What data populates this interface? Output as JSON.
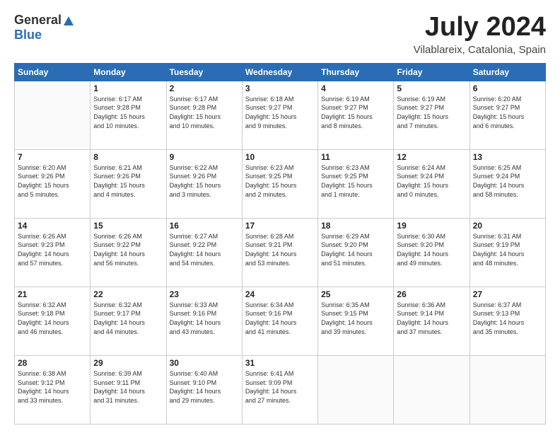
{
  "logo": {
    "general": "General",
    "blue": "Blue"
  },
  "header": {
    "title": "July 2024",
    "subtitle": "Vilablareix, Catalonia, Spain"
  },
  "weekdays": [
    "Sunday",
    "Monday",
    "Tuesday",
    "Wednesday",
    "Thursday",
    "Friday",
    "Saturday"
  ],
  "weeks": [
    [
      {
        "day": "",
        "info": ""
      },
      {
        "day": "1",
        "info": "Sunrise: 6:17 AM\nSunset: 9:28 PM\nDaylight: 15 hours\nand 10 minutes."
      },
      {
        "day": "2",
        "info": "Sunrise: 6:17 AM\nSunset: 9:28 PM\nDaylight: 15 hours\nand 10 minutes."
      },
      {
        "day": "3",
        "info": "Sunrise: 6:18 AM\nSunset: 9:27 PM\nDaylight: 15 hours\nand 9 minutes."
      },
      {
        "day": "4",
        "info": "Sunrise: 6:19 AM\nSunset: 9:27 PM\nDaylight: 15 hours\nand 8 minutes."
      },
      {
        "day": "5",
        "info": "Sunrise: 6:19 AM\nSunset: 9:27 PM\nDaylight: 15 hours\nand 7 minutes."
      },
      {
        "day": "6",
        "info": "Sunrise: 6:20 AM\nSunset: 9:27 PM\nDaylight: 15 hours\nand 6 minutes."
      }
    ],
    [
      {
        "day": "7",
        "info": "Sunrise: 6:20 AM\nSunset: 9:26 PM\nDaylight: 15 hours\nand 5 minutes."
      },
      {
        "day": "8",
        "info": "Sunrise: 6:21 AM\nSunset: 9:26 PM\nDaylight: 15 hours\nand 4 minutes."
      },
      {
        "day": "9",
        "info": "Sunrise: 6:22 AM\nSunset: 9:26 PM\nDaylight: 15 hours\nand 3 minutes."
      },
      {
        "day": "10",
        "info": "Sunrise: 6:23 AM\nSunset: 9:25 PM\nDaylight: 15 hours\nand 2 minutes."
      },
      {
        "day": "11",
        "info": "Sunrise: 6:23 AM\nSunset: 9:25 PM\nDaylight: 15 hours\nand 1 minute."
      },
      {
        "day": "12",
        "info": "Sunrise: 6:24 AM\nSunset: 9:24 PM\nDaylight: 15 hours\nand 0 minutes."
      },
      {
        "day": "13",
        "info": "Sunrise: 6:25 AM\nSunset: 9:24 PM\nDaylight: 14 hours\nand 58 minutes."
      }
    ],
    [
      {
        "day": "14",
        "info": "Sunrise: 6:26 AM\nSunset: 9:23 PM\nDaylight: 14 hours\nand 57 minutes."
      },
      {
        "day": "15",
        "info": "Sunrise: 6:26 AM\nSunset: 9:22 PM\nDaylight: 14 hours\nand 56 minutes."
      },
      {
        "day": "16",
        "info": "Sunrise: 6:27 AM\nSunset: 9:22 PM\nDaylight: 14 hours\nand 54 minutes."
      },
      {
        "day": "17",
        "info": "Sunrise: 6:28 AM\nSunset: 9:21 PM\nDaylight: 14 hours\nand 53 minutes."
      },
      {
        "day": "18",
        "info": "Sunrise: 6:29 AM\nSunset: 9:20 PM\nDaylight: 14 hours\nand 51 minutes."
      },
      {
        "day": "19",
        "info": "Sunrise: 6:30 AM\nSunset: 9:20 PM\nDaylight: 14 hours\nand 49 minutes."
      },
      {
        "day": "20",
        "info": "Sunrise: 6:31 AM\nSunset: 9:19 PM\nDaylight: 14 hours\nand 48 minutes."
      }
    ],
    [
      {
        "day": "21",
        "info": "Sunrise: 6:32 AM\nSunset: 9:18 PM\nDaylight: 14 hours\nand 46 minutes."
      },
      {
        "day": "22",
        "info": "Sunrise: 6:32 AM\nSunset: 9:17 PM\nDaylight: 14 hours\nand 44 minutes."
      },
      {
        "day": "23",
        "info": "Sunrise: 6:33 AM\nSunset: 9:16 PM\nDaylight: 14 hours\nand 43 minutes."
      },
      {
        "day": "24",
        "info": "Sunrise: 6:34 AM\nSunset: 9:16 PM\nDaylight: 14 hours\nand 41 minutes."
      },
      {
        "day": "25",
        "info": "Sunrise: 6:35 AM\nSunset: 9:15 PM\nDaylight: 14 hours\nand 39 minutes."
      },
      {
        "day": "26",
        "info": "Sunrise: 6:36 AM\nSunset: 9:14 PM\nDaylight: 14 hours\nand 37 minutes."
      },
      {
        "day": "27",
        "info": "Sunrise: 6:37 AM\nSunset: 9:13 PM\nDaylight: 14 hours\nand 35 minutes."
      }
    ],
    [
      {
        "day": "28",
        "info": "Sunrise: 6:38 AM\nSunset: 9:12 PM\nDaylight: 14 hours\nand 33 minutes."
      },
      {
        "day": "29",
        "info": "Sunrise: 6:39 AM\nSunset: 9:11 PM\nDaylight: 14 hours\nand 31 minutes."
      },
      {
        "day": "30",
        "info": "Sunrise: 6:40 AM\nSunset: 9:10 PM\nDaylight: 14 hours\nand 29 minutes."
      },
      {
        "day": "31",
        "info": "Sunrise: 6:41 AM\nSunset: 9:09 PM\nDaylight: 14 hours\nand 27 minutes."
      },
      {
        "day": "",
        "info": ""
      },
      {
        "day": "",
        "info": ""
      },
      {
        "day": "",
        "info": ""
      }
    ]
  ]
}
